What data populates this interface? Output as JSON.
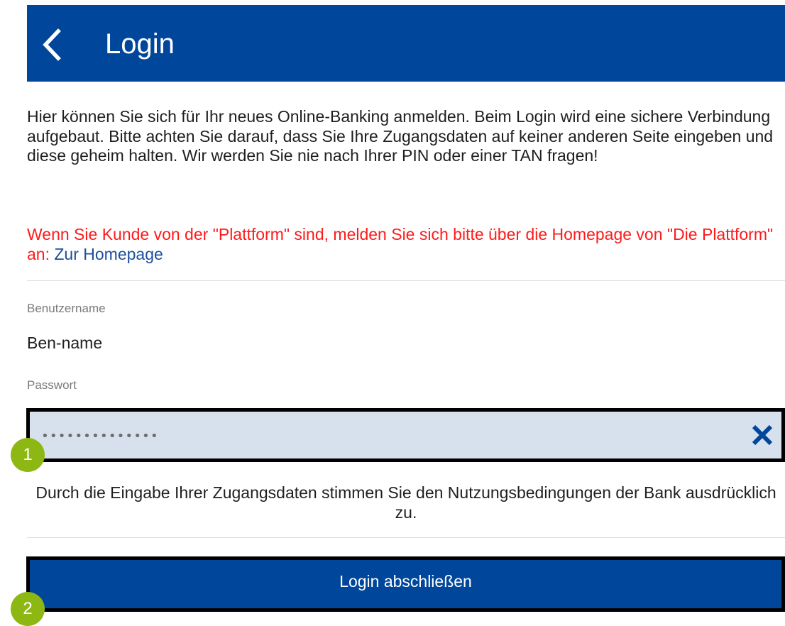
{
  "header": {
    "title": "Login",
    "back_icon": "chevron-left-icon",
    "background": "#00479b"
  },
  "intro": {
    "text": "Hier können Sie sich für Ihr neues Online-Banking anmelden. Beim Login wird eine sichere Verbindung aufgebaut. Bitte achten Sie darauf, dass Sie Ihre Zugangsdaten auf keiner anderen Seite eingeben und diese geheim halten. Wir werden Sie nie nach Ihrer PIN oder einer TAN fragen!"
  },
  "notice": {
    "text": "Wenn Sie Kunde von der \"Plattform\" sind, melden Sie sich bitte über die Homepage von \"Die Plattform\" an:",
    "link_label": "Zur Homepage",
    "color": "#ff1a1a",
    "link_color": "#1d4f9c"
  },
  "form": {
    "username_label": "Benutzername",
    "username_value": "Ben-name",
    "password_label": "Passwort",
    "password_value": "••••••••••••••",
    "clear_icon": "close-icon",
    "terms_text": "Durch die Eingabe Ihrer Zugangsdaten stimmen Sie den Nutzungsbedingungen der Bank ausdrücklich zu.",
    "submit_label": "Login abschließen"
  },
  "annotations": {
    "step1": "1",
    "step2": "2",
    "badge_color": "#8db814"
  }
}
